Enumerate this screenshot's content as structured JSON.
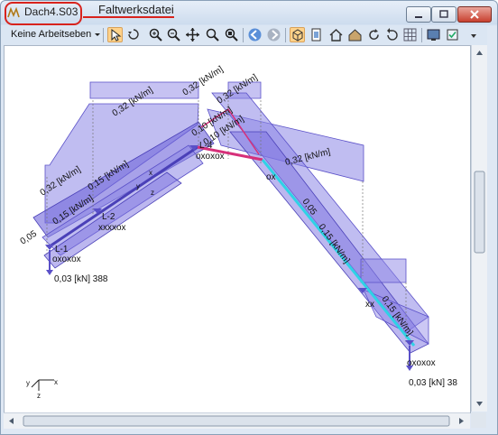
{
  "window": {
    "title": "Dach4.S03",
    "annotation": "Faltwerksdatei"
  },
  "toolbar": {
    "dropdown_label": "Keine Arbeitseben",
    "icons": [
      "pointer-icon",
      "rotate-view-icon",
      "zoom-in-icon",
      "zoom-out-icon",
      "pan-icon",
      "zoom-window-icon",
      "zoom-fit-icon",
      "back-icon",
      "forward-icon",
      "3d-box-icon",
      "front-view-icon",
      "house-icon",
      "render-icon",
      "refresh-icon",
      "undo-icon",
      "grid-icon",
      "display-icon",
      "options-icon"
    ]
  },
  "labels": {
    "load_032": "0,32 [kN/m]",
    "load_015": "0,15 [kN/m]",
    "load_010": "0,10 [kN/m]",
    "load_005": "0,05",
    "reaction_left": "0,03 [kN] 388",
    "reaction_right": "0,03 [kN] 38",
    "support_1": "L-1",
    "support_2": "L-2",
    "support_4": "L-4",
    "oxo": "oxoxox",
    "xxx": "xxxxox",
    "oxo2": "ox",
    "xx": "xx",
    "axis_x": "x",
    "axis_y": "y",
    "axis_z": "z",
    "kn_m": "kN/m",
    "frag_0": "0,",
    "frag_l": "L-",
    "frag_15": "0,15"
  },
  "colors": {
    "load_fill": "#8d86e6",
    "load_stroke": "#5a50c8",
    "member_highlight": "#d6307a",
    "member_cyan": "#2fd2e6",
    "title_highlight": "#d8231d"
  }
}
